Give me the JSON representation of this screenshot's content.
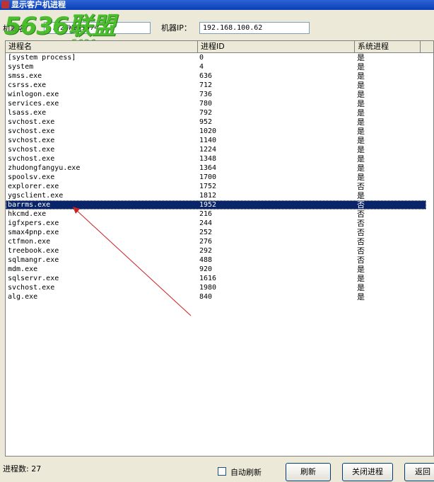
{
  "window": {
    "title": "显示客户机进程"
  },
  "form": {
    "machine_name_label": "机器名",
    "machine_name_value": "...24W931574",
    "machine_ip_label": "机器IP：",
    "machine_ip_value": "192.168.100.62"
  },
  "watermark": {
    "logo": "5636联盟",
    "url": "www.5636.com"
  },
  "list": {
    "columns": [
      "进程名",
      "进程ID",
      "系统进程"
    ],
    "rows": [
      {
        "name": "[system process]",
        "pid": "0",
        "sys": "是"
      },
      {
        "name": "system",
        "pid": "4",
        "sys": "是"
      },
      {
        "name": "smss.exe",
        "pid": "636",
        "sys": "是"
      },
      {
        "name": "csrss.exe",
        "pid": "712",
        "sys": "是"
      },
      {
        "name": "winlogon.exe",
        "pid": "736",
        "sys": "是"
      },
      {
        "name": "services.exe",
        "pid": "780",
        "sys": "是"
      },
      {
        "name": "lsass.exe",
        "pid": "792",
        "sys": "是"
      },
      {
        "name": "svchost.exe",
        "pid": "952",
        "sys": "是"
      },
      {
        "name": "svchost.exe",
        "pid": "1020",
        "sys": "是"
      },
      {
        "name": "svchost.exe",
        "pid": "1140",
        "sys": "是"
      },
      {
        "name": "svchost.exe",
        "pid": "1224",
        "sys": "是"
      },
      {
        "name": "svchost.exe",
        "pid": "1348",
        "sys": "是"
      },
      {
        "name": "zhudongfangyu.exe",
        "pid": "1364",
        "sys": "是"
      },
      {
        "name": "spoolsv.exe",
        "pid": "1700",
        "sys": "是"
      },
      {
        "name": "explorer.exe",
        "pid": "1752",
        "sys": "否"
      },
      {
        "name": "ygsclient.exe",
        "pid": "1812",
        "sys": "是"
      },
      {
        "name": "barrms.exe",
        "pid": "1952",
        "sys": "否",
        "selected": true
      },
      {
        "name": "hkcmd.exe",
        "pid": "216",
        "sys": "否"
      },
      {
        "name": "igfxpers.exe",
        "pid": "244",
        "sys": "否"
      },
      {
        "name": "smax4pnp.exe",
        "pid": "252",
        "sys": "否"
      },
      {
        "name": "ctfmon.exe",
        "pid": "276",
        "sys": "否"
      },
      {
        "name": "treebook.exe",
        "pid": "292",
        "sys": "否"
      },
      {
        "name": "sqlmangr.exe",
        "pid": "488",
        "sys": "否"
      },
      {
        "name": "mdm.exe",
        "pid": "920",
        "sys": "是"
      },
      {
        "name": "sqlservr.exe",
        "pid": "1616",
        "sys": "是"
      },
      {
        "name": "svchost.exe",
        "pid": "1980",
        "sys": "是"
      },
      {
        "name": "alg.exe",
        "pid": "840",
        "sys": "是"
      }
    ]
  },
  "status": {
    "process_count": "进程数: 27"
  },
  "controls": {
    "auto_refresh_label": "自动刷新",
    "auto_refresh_checked": false,
    "refresh_button": "刷新",
    "kill_button": "关闭进程",
    "back_button": "返回"
  },
  "colors": {
    "selection": "#0a246a",
    "annotation_arrow": "#cc2020",
    "watermark": "#3fbb1f"
  }
}
